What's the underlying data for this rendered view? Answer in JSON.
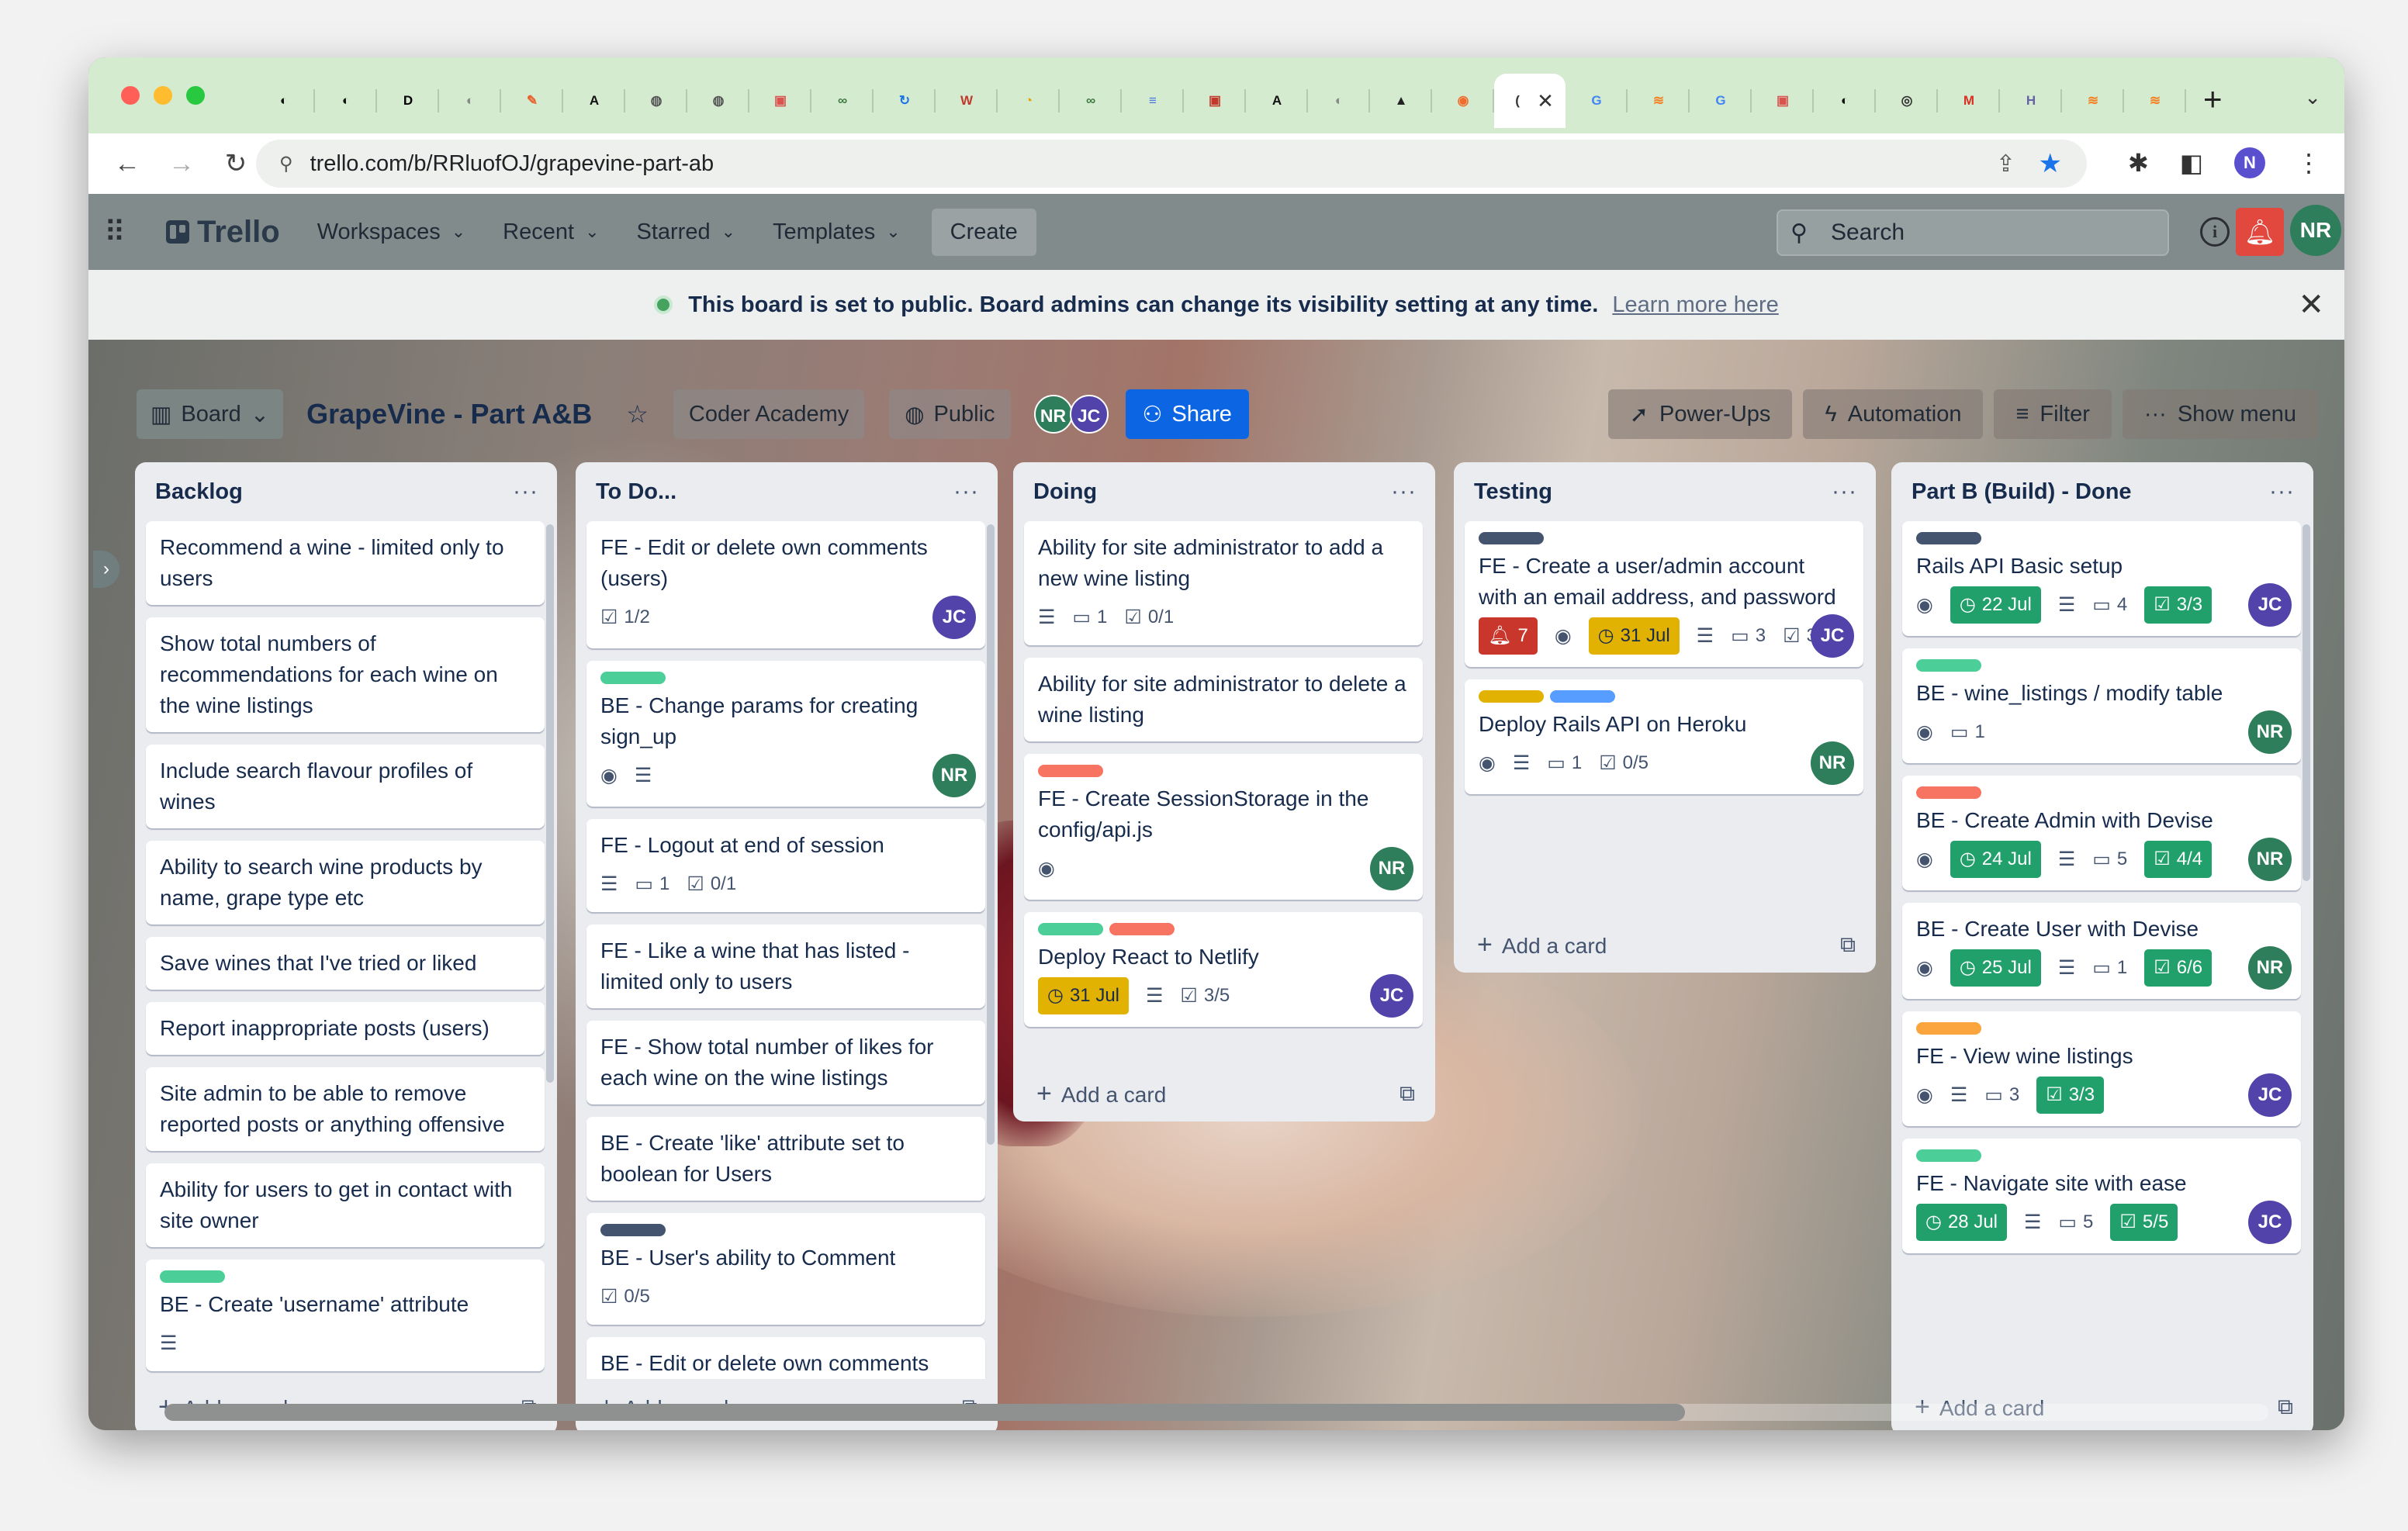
{
  "browser": {
    "tabs": [
      {
        "icon": "github-icon",
        "glyph": "◐",
        "color": "#111"
      },
      {
        "icon": "github-icon",
        "glyph": "◐",
        "color": "#111"
      },
      {
        "icon": "dev-icon",
        "glyph": "D",
        "color": "#000"
      },
      {
        "icon": "github-icon",
        "glyph": "◐",
        "color": "#888"
      },
      {
        "icon": "postman-icon",
        "glyph": "✎",
        "color": "#e8612c"
      },
      {
        "icon": "app-icon",
        "glyph": "A",
        "color": "#111"
      },
      {
        "icon": "globe-icon",
        "glyph": "◍",
        "color": "#555"
      },
      {
        "icon": "globe-icon",
        "glyph": "◍",
        "color": "#555"
      },
      {
        "icon": "photo-icon",
        "glyph": "▣",
        "color": "#d9534f"
      },
      {
        "icon": "link-icon",
        "glyph": "∞",
        "color": "#3c7a3c"
      },
      {
        "icon": "sync-icon",
        "glyph": "↻",
        "color": "#1a73e8"
      },
      {
        "icon": "wiki-icon",
        "glyph": "W",
        "color": "#c0392b"
      },
      {
        "icon": "chart-icon",
        "glyph": "◔",
        "color": "#e8a200"
      },
      {
        "icon": "link-icon",
        "glyph": "∞",
        "color": "#3c7a3c"
      },
      {
        "icon": "docs-icon",
        "glyph": "≡",
        "color": "#4a78e0"
      },
      {
        "icon": "photo-icon",
        "glyph": "▣",
        "color": "#c0392b"
      },
      {
        "icon": "terminal-icon",
        "glyph": "A",
        "color": "#111"
      },
      {
        "icon": "github-icon",
        "glyph": "◐",
        "color": "#888"
      },
      {
        "icon": "arrow-icon",
        "glyph": "▲",
        "color": "#222"
      },
      {
        "icon": "postman-icon",
        "glyph": "◉",
        "color": "#f06d2c"
      },
      {
        "icon": "trello-icon",
        "glyph": "(",
        "color": "#333",
        "active": true
      },
      {
        "icon": "google-icon",
        "glyph": "G",
        "color": "#4285f4"
      },
      {
        "icon": "stack-icon",
        "glyph": "≋",
        "color": "#f48024"
      },
      {
        "icon": "google-icon",
        "glyph": "G",
        "color": "#4285f4"
      },
      {
        "icon": "photo-icon",
        "glyph": "▣",
        "color": "#d9534f"
      },
      {
        "icon": "github-icon",
        "glyph": "◐",
        "color": "#111"
      },
      {
        "icon": "chrome-icon",
        "glyph": "◎",
        "color": "#333"
      },
      {
        "icon": "gmail-icon",
        "glyph": "M",
        "color": "#d93025"
      },
      {
        "icon": "heroku-icon",
        "glyph": "H",
        "color": "#6762a6"
      },
      {
        "icon": "stack-icon",
        "glyph": "≋",
        "color": "#f48024"
      },
      {
        "icon": "stack-icon",
        "glyph": "≋",
        "color": "#f48024"
      }
    ],
    "url": "trello.com/b/RRluofOJ/grapevine-part-ab",
    "profile_initial": "N"
  },
  "header": {
    "logo": "Trello",
    "menu": [
      "Workspaces",
      "Recent",
      "Starred",
      "Templates"
    ],
    "create": "Create",
    "search_placeholder": "Search",
    "avatar": "NR"
  },
  "banner": {
    "message": "This board is set to public. Board admins can change its visibility setting at any time.",
    "link": "Learn more here"
  },
  "board": {
    "view": "Board",
    "title": "GrapeVine - Part A&B",
    "workspace": "Coder Academy",
    "visibility": "Public",
    "members": [
      "NR",
      "JC"
    ],
    "share": "Share",
    "right_buttons": [
      "Power-Ups",
      "Automation",
      "Filter",
      "Show menu"
    ],
    "add_card": "Add a card"
  },
  "colors": {
    "green": "#4bce97",
    "red": "#f87462",
    "yellow": "#e2b203",
    "blue": "#579dff",
    "dark": "#44546f",
    "orange": "#faa53d"
  },
  "lists": [
    {
      "title": "Backlog",
      "cards": [
        {
          "text": "Recommend a wine - limited only to users"
        },
        {
          "text": "Show total numbers of recommendations for each wine on the wine listings"
        },
        {
          "text": "Include search flavour profiles of wines"
        },
        {
          "text": "Ability to search wine products by name, grape type etc"
        },
        {
          "text": "Save wines that I've tried or liked"
        },
        {
          "text": "Report inappropriate posts (users)"
        },
        {
          "text": "Site admin to be able to remove reported posts or anything offensive"
        },
        {
          "text": "Ability for users to get in contact with site owner"
        },
        {
          "text": "BE - Create 'username' attribute",
          "labels": [
            "green"
          ],
          "badges": [
            {
              "t": "desc"
            }
          ]
        }
      ]
    },
    {
      "title": "To Do...",
      "cards": [
        {
          "text": "FE - Edit or delete own comments (users)",
          "badges": [
            {
              "t": "check",
              "v": "1/2"
            }
          ],
          "member": "JC"
        },
        {
          "text": "BE - Change params for creating sign_up",
          "labels": [
            "green"
          ],
          "badges": [
            {
              "t": "watch"
            },
            {
              "t": "desc"
            }
          ],
          "member": "NR"
        },
        {
          "text": "FE - Logout at end of session",
          "badges": [
            {
              "t": "desc"
            },
            {
              "t": "comment",
              "v": "1"
            },
            {
              "t": "check",
              "v": "0/1"
            }
          ]
        },
        {
          "text": "FE - Like a wine that has listed - limited only to users"
        },
        {
          "text": "FE - Show total number of likes for each wine on the wine listings"
        },
        {
          "text": "BE - Create 'like' attribute set to boolean for Users"
        },
        {
          "text": "BE - User's ability to Comment",
          "labels": [
            "dark"
          ],
          "badges": [
            {
              "t": "check",
              "v": "0/5"
            }
          ]
        },
        {
          "text": "BE - Edit or delete own comments"
        }
      ]
    },
    {
      "title": "Doing",
      "cards": [
        {
          "text": "Ability for site administrator to add a new wine listing",
          "badges": [
            {
              "t": "desc"
            },
            {
              "t": "comment",
              "v": "1"
            },
            {
              "t": "check",
              "v": "0/1"
            }
          ]
        },
        {
          "text": "Ability for site administrator to delete a wine listing"
        },
        {
          "text": "FE - Create SessionStorage in the config/api.js",
          "labels": [
            "red"
          ],
          "badges": [
            {
              "t": "watch"
            }
          ],
          "member": "NR"
        },
        {
          "text": "Deploy React to Netlify",
          "labels": [
            "green",
            "red"
          ],
          "badges": [
            {
              "t": "due",
              "v": "31 Jul",
              "c": "yel"
            },
            {
              "t": "desc"
            },
            {
              "t": "check",
              "v": "3/5"
            }
          ],
          "member": "JC"
        }
      ]
    },
    {
      "title": "Testing",
      "cards": [
        {
          "text": "FE - Create a user/admin account with an email address, and password",
          "labels": [
            "dark"
          ],
          "badges": [
            {
              "t": "red",
              "v": "7"
            },
            {
              "t": "watch"
            },
            {
              "t": "due",
              "v": "31 Jul",
              "c": "yel"
            },
            {
              "t": "desc"
            },
            {
              "t": "comment",
              "v": "3"
            },
            {
              "t": "check",
              "v": "3/5"
            }
          ],
          "member": "JC"
        },
        {
          "text": "Deploy Rails API on Heroku",
          "labels": [
            "yellow",
            "blue"
          ],
          "badges": [
            {
              "t": "watch"
            },
            {
              "t": "desc"
            },
            {
              "t": "comment",
              "v": "1"
            },
            {
              "t": "check",
              "v": "0/5"
            }
          ],
          "member": "NR"
        }
      ]
    },
    {
      "title": "Part B (Build) - Done",
      "cards": [
        {
          "text": "Rails API Basic setup",
          "labels": [
            "dark"
          ],
          "badges": [
            {
              "t": "watch"
            },
            {
              "t": "due",
              "v": "22 Jul"
            },
            {
              "t": "desc"
            },
            {
              "t": "comment",
              "v": "4"
            },
            {
              "t": "chk",
              "v": "3/3"
            }
          ],
          "member": "JC"
        },
        {
          "text": "BE - wine_listings / modify table",
          "labels": [
            "green"
          ],
          "badges": [
            {
              "t": "watch"
            },
            {
              "t": "comment",
              "v": "1"
            }
          ],
          "member": "NR"
        },
        {
          "text": "BE - Create Admin with Devise",
          "labels": [
            "red"
          ],
          "badges": [
            {
              "t": "watch"
            },
            {
              "t": "due",
              "v": "24 Jul"
            },
            {
              "t": "desc"
            },
            {
              "t": "comment",
              "v": "5"
            },
            {
              "t": "chk",
              "v": "4/4"
            }
          ],
          "member": "NR"
        },
        {
          "text": "BE - Create User with Devise",
          "badges": [
            {
              "t": "watch"
            },
            {
              "t": "due",
              "v": "25 Jul"
            },
            {
              "t": "desc"
            },
            {
              "t": "comment",
              "v": "1"
            },
            {
              "t": "chk",
              "v": "6/6"
            }
          ],
          "member": "NR"
        },
        {
          "text": "FE - View wine listings",
          "labels": [
            "orange"
          ],
          "badges": [
            {
              "t": "watch"
            },
            {
              "t": "desc"
            },
            {
              "t": "comment",
              "v": "3"
            },
            {
              "t": "chk",
              "v": "3/3"
            }
          ],
          "member": "JC"
        },
        {
          "text": "FE - Navigate site with ease",
          "labels": [
            "green"
          ],
          "badges": [
            {
              "t": "due",
              "v": "28 Jul"
            },
            {
              "t": "desc"
            },
            {
              "t": "comment",
              "v": "5"
            },
            {
              "t": "chk",
              "v": "5/5"
            }
          ],
          "member": "JC"
        }
      ]
    }
  ]
}
